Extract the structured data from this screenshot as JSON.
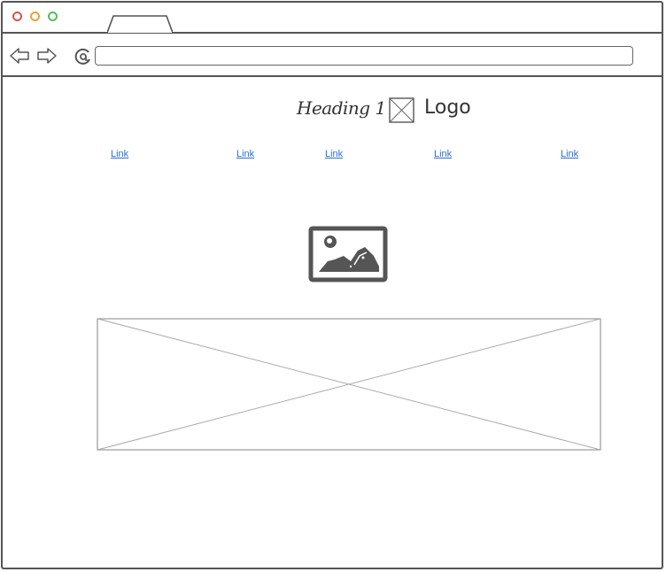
{
  "window": {
    "traffic_lights": [
      {
        "name": "close",
        "color": "#d9534f"
      },
      {
        "name": "minimize",
        "color": "#e8a23a"
      },
      {
        "name": "zoom",
        "color": "#5cb85c"
      }
    ],
    "url_value": ""
  },
  "page": {
    "heading": "Heading 1",
    "logo_label": "Logo",
    "nav_links": [
      "Link",
      "Link",
      "Link",
      "Link",
      "Link"
    ],
    "link_color": "#2a6fd6"
  },
  "icons": {
    "back": "back-arrow-icon",
    "forward": "forward-arrow-icon",
    "reload": "reload-icon",
    "image": "image-icon",
    "placeholder": "image-placeholder-icon"
  }
}
